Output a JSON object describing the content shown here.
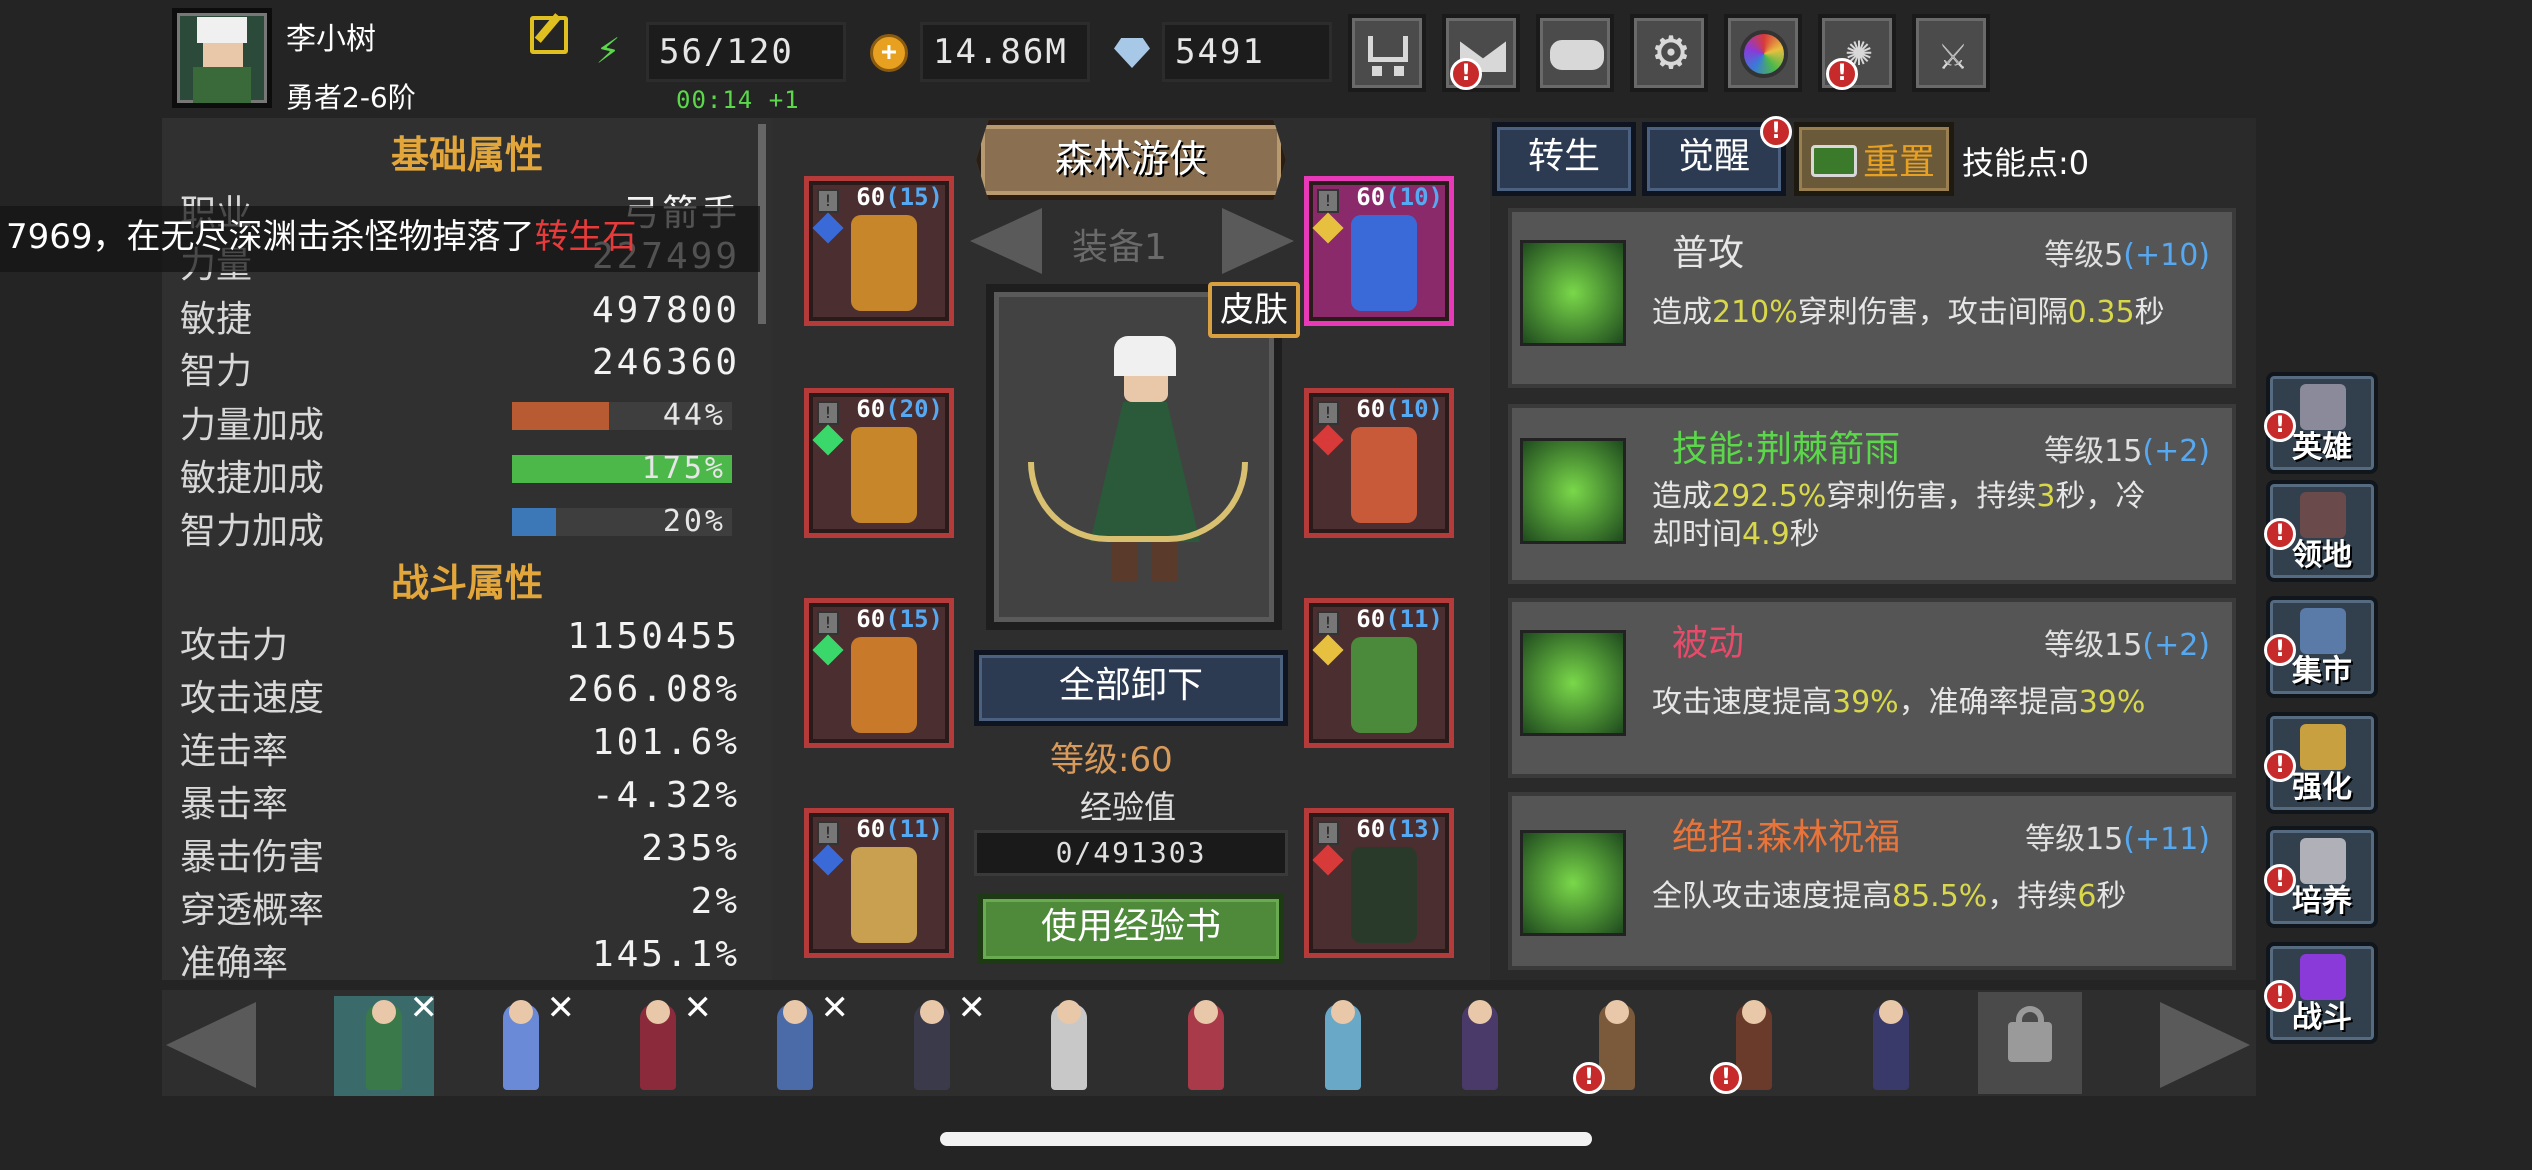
{
  "player": {
    "name": "李小树",
    "rank": "勇者2-6阶"
  },
  "stamina": {
    "value": "56/120",
    "timer": "00:14 +1"
  },
  "gold": "14.86M",
  "gems": "5491",
  "top_buttons": [
    "shop",
    "mail",
    "gamepad",
    "settings",
    "lens",
    "fireworks",
    "swords"
  ],
  "basic_section": "基础属性",
  "basic_rows": [
    {
      "label": "职业",
      "value": "弓箭手"
    },
    {
      "label": "力量",
      "value": "227499"
    },
    {
      "label": "敏捷",
      "value": "497800"
    },
    {
      "label": "智力",
      "value": "246360"
    }
  ],
  "bonus_rows": [
    {
      "label": "力量加成",
      "value": "44%",
      "level": 0.44,
      "color": "#b85a32"
    },
    {
      "label": "敏捷加成",
      "value": "175%",
      "level": 1.0,
      "color": "#4cb84a"
    },
    {
      "label": "智力加成",
      "value": "20%",
      "level": 0.2,
      "color": "#3c78b8"
    }
  ],
  "combat_section": "战斗属性",
  "combat_rows": [
    {
      "label": "攻击力",
      "value": "1150455"
    },
    {
      "label": "攻击速度",
      "value": "266.08%"
    },
    {
      "label": "连击率",
      "value": "101.6%"
    },
    {
      "label": "暴击率",
      "value": "-4.32%"
    },
    {
      "label": "暴击伤害",
      "value": "235%"
    },
    {
      "label": "穿透概率",
      "value": "2%"
    },
    {
      "label": "准确率",
      "value": "145.1%"
    }
  ],
  "broadcast": {
    "prefix": "7969，在无尽深渊击杀怪物掉落了",
    "item": "转生石"
  },
  "hero_title": "森林游侠",
  "equip_set": "装备1",
  "skin_label": "皮肤",
  "equipment_left": [
    {
      "level": "60",
      "plus": "(15)",
      "gem": "#3a6ad8"
    },
    {
      "level": "60",
      "plus": "(20)",
      "gem": "#3ad86a"
    },
    {
      "level": "60",
      "plus": "(15)",
      "gem": "#3ad86a"
    },
    {
      "level": "60",
      "plus": "(11)",
      "gem": "#3a6ad8"
    }
  ],
  "equipment_right": [
    {
      "level": "60",
      "plus": "(10)",
      "gem": "#e8c040"
    },
    {
      "level": "60",
      "plus": "(10)",
      "gem": "#d83a3a"
    },
    {
      "level": "60",
      "plus": "(11)",
      "gem": "#e8c040"
    },
    {
      "level": "60",
      "plus": "(13)",
      "gem": "#d83a3a"
    }
  ],
  "unequip_all": "全部卸下",
  "hero_level": "等级:60",
  "exp_label": "经验值",
  "exp_value": "0/491303",
  "use_exp_book": "使用经验书",
  "tabs": {
    "rebirth": "转生",
    "awaken": "觉醒",
    "reset": "重置",
    "skill_points": "技能点:0"
  },
  "skills": [
    {
      "name": "普攻",
      "name_color": "#e6e6e6",
      "level": "等级5",
      "bonus": "(+10)",
      "desc": [
        [
          "造成",
          "210%",
          "穿刺伤害，攻击间隔",
          "0.35",
          "秒"
        ]
      ]
    },
    {
      "name": "技能:荆棘箭雨",
      "name_color": "#5ad84a",
      "level": "等级15",
      "bonus": "(+2)",
      "desc": [
        [
          "造成",
          "292.5%",
          "穿刺伤害，持续",
          "3",
          "秒，冷"
        ],
        [
          "却时间",
          "4.9",
          "秒"
        ]
      ]
    },
    {
      "name": "被动",
      "name_color": "#e84a6a",
      "level": "等级15",
      "bonus": "(+2)",
      "desc": [
        [
          "攻击速度提高",
          "39%",
          "，准确率提高",
          "39%",
          ""
        ]
      ]
    },
    {
      "name": "绝招:森林祝福",
      "name_color": "#e8743a",
      "level": "等级15",
      "bonus": "(+11)",
      "desc": [
        [
          "全队攻击速度提高",
          "85.5%",
          "，持续",
          "6",
          "秒"
        ]
      ]
    }
  ],
  "side_menu": [
    {
      "label": "英雄",
      "icon": "helmet-icon",
      "color": "#8a8a9a"
    },
    {
      "label": "领地",
      "icon": "castle-icon",
      "color": "#6a4a4a"
    },
    {
      "label": "集市",
      "icon": "market-icon",
      "color": "#5a7aa8"
    },
    {
      "label": "强化",
      "icon": "crest-icon",
      "color": "#c8a040"
    },
    {
      "label": "培养",
      "icon": "chalice-icon",
      "color": "#b0b0b8"
    },
    {
      "label": "战斗",
      "icon": "portal-icon",
      "color": "#8a3ad8"
    }
  ],
  "heroes": [
    {
      "color": "#3a7a4a",
      "x": true
    },
    {
      "color": "#6a8ad8",
      "x": true
    },
    {
      "color": "#8a2a3a",
      "x": true
    },
    {
      "color": "#4a6aa8",
      "x": true
    },
    {
      "color": "#3a3a4a",
      "x": true
    },
    {
      "color": "#c8c8c8",
      "x": false
    },
    {
      "color": "#a83a4a",
      "x": false
    },
    {
      "color": "#6aa8c8",
      "x": false
    },
    {
      "color": "#4a3a6a",
      "x": false
    },
    {
      "color": "#7a5a3a",
      "x": false
    },
    {
      "color": "#6a3a2a",
      "x": false
    },
    {
      "color": "#3a3a6a",
      "x": false
    }
  ]
}
